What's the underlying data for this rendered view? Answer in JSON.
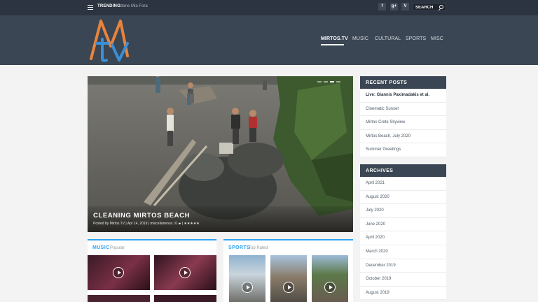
{
  "topbar": {
    "trending_label": "TRENDING:",
    "trending_text": "Itane Mia Fora",
    "social": [
      {
        "icon": "facebook-icon",
        "glyph": "f"
      },
      {
        "icon": "google-plus-icon",
        "glyph": "g+"
      },
      {
        "icon": "vimeo-icon",
        "glyph": "V"
      }
    ],
    "search_placeholder": "SEARCH"
  },
  "header": {
    "nav": [
      {
        "label": "MIRTOS.TV",
        "active": true
      },
      {
        "label": "MUSIC"
      },
      {
        "label": "CULTURAL"
      },
      {
        "label": "SPORTS"
      },
      {
        "label": "MISC"
      }
    ]
  },
  "hero": {
    "title": "CLEANING MIRTOS BEACH",
    "meta": "Posted by Mirtos.TV | Apr 14, 2019 | miscellaneous | 0 ▰ | ★★★★★"
  },
  "music": {
    "title": "MUSIC",
    "subtitle": "Popular"
  },
  "sports": {
    "title": "SPORTS",
    "subtitle": "Top Rated"
  },
  "recent_posts": {
    "title": "RECENT POSTS",
    "items": [
      "Live: Giannis Paximadakis et al.",
      "Cinematic Sunset",
      "Mirtos Crete Skyview",
      "Mirtos Beach, July 2020",
      "Summer Greetings"
    ]
  },
  "archives": {
    "title": "ARCHIVES",
    "items": [
      "April 2021",
      "August 2020",
      "July 2020",
      "June 2020",
      "April 2020",
      "March 2020",
      "December 2019",
      "October 2019",
      "August 2019"
    ]
  },
  "colors": {
    "accent": "#2ea3f2",
    "topbar": "#2b3440",
    "header": "#3a4653",
    "logo_orange": "#e8843d",
    "logo_blue": "#3a8fd6"
  }
}
